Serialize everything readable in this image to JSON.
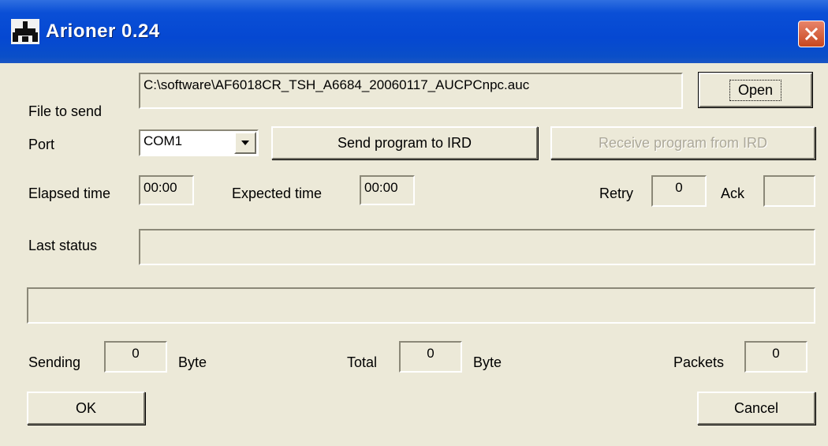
{
  "window": {
    "title": "Arioner 0.24"
  },
  "icons": {
    "app": "joystick-icon",
    "close": "close-icon",
    "dropdown": "chevron-down-icon"
  },
  "colors": {
    "titlebar": "#0548d2",
    "close_button": "#d4562a",
    "face": "#ece9d8"
  },
  "file": {
    "label": "File to send",
    "path": "C:\\software\\AF6018CR_TSH_A6684_20060117_AUCPCnpc.auc",
    "open_label": "Open"
  },
  "port": {
    "label": "Port",
    "selected": "COM1"
  },
  "actions": {
    "send_label": "Send program to IRD",
    "receive_label": "Receive program from IRD"
  },
  "timing": {
    "elapsed_label": "Elapsed time",
    "elapsed_value": "00:00",
    "expected_label": "Expected time",
    "expected_value": "00:00",
    "retry_label": "Retry",
    "retry_value": "0",
    "ack_label": "Ack",
    "ack_value": ""
  },
  "status": {
    "label": "Last status",
    "value": ""
  },
  "progress": {
    "value": 0
  },
  "counters": {
    "sending_label": "Sending",
    "sending_value": "0",
    "sending_unit": "Byte",
    "total_label": "Total",
    "total_value": "0",
    "total_unit": "Byte",
    "packets_label": "Packets",
    "packets_value": "0"
  },
  "buttons": {
    "ok_label": "OK",
    "cancel_label": "Cancel"
  }
}
